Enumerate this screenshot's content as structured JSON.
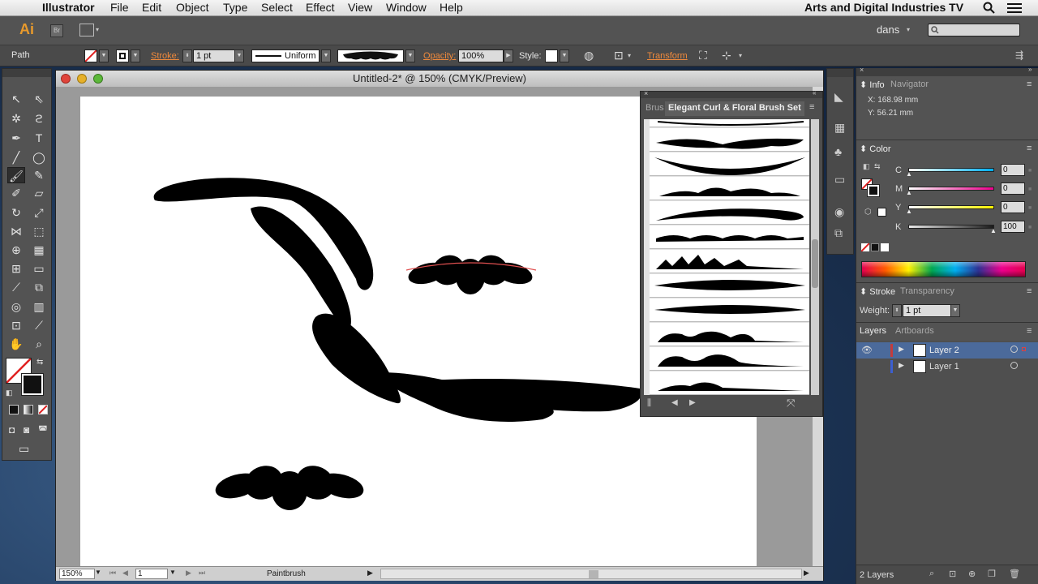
{
  "menubar": {
    "app_name": "Illustrator",
    "items": [
      "File",
      "Edit",
      "Object",
      "Type",
      "Select",
      "Effect",
      "View",
      "Window",
      "Help"
    ],
    "right_title": "Arts and Digital Industries TV"
  },
  "appbar": {
    "logo": "Ai",
    "br_label": "Br",
    "workspace": "dans",
    "search_placeholder": ""
  },
  "controlbar": {
    "selection_type": "Path",
    "stroke_label": "Stroke:",
    "stroke_weight": "1 pt",
    "profile": "Uniform",
    "opacity_label": "Opacity:",
    "opacity_value": "100%",
    "style_label": "Style:",
    "transform_label": "Transform"
  },
  "document": {
    "title": "Untitled-2* @ 150% (CMYK/Preview)",
    "zoom": "150%",
    "page": "1",
    "status_tool": "Paintbrush"
  },
  "brushes": {
    "tab_short": "Brus",
    "tab_active": "Elegant Curl & Floral Brush Set",
    "row_count": 12
  },
  "info": {
    "tab": "Info",
    "tab2": "Navigator",
    "x": "X:  168.98 mm",
    "y": "Y:  56.21 mm"
  },
  "color": {
    "tab": "Color",
    "channels": [
      {
        "label": "C",
        "value": "0"
      },
      {
        "label": "M",
        "value": "0"
      },
      {
        "label": "Y",
        "value": "0"
      },
      {
        "label": "K",
        "value": "100"
      }
    ]
  },
  "stroke": {
    "tab": "Stroke",
    "tab2": "Transparency",
    "weight_label": "Weight:",
    "weight": "1 pt"
  },
  "layers": {
    "tab": "Layers",
    "tab2": "Artboards",
    "rows": [
      {
        "name": "Layer 2",
        "color": "#c43c3c",
        "selected": true
      },
      {
        "name": "Layer 1",
        "color": "#3c5fd0",
        "selected": false
      }
    ],
    "count": "2 Layers"
  },
  "colors": {
    "accent_orange": "#f08a3c",
    "selection_blue": "#4b6a9b"
  }
}
